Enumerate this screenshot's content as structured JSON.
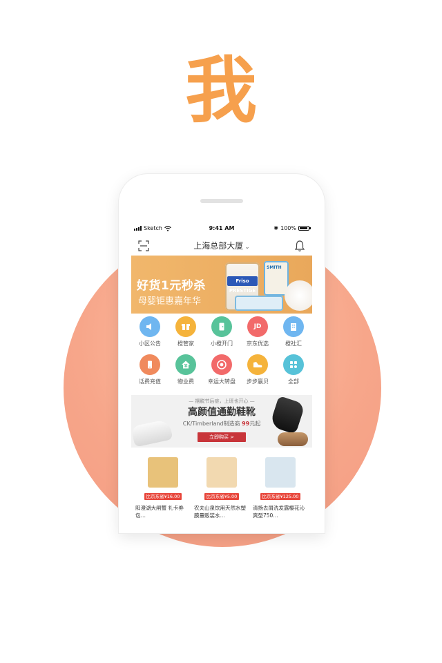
{
  "hero": {
    "title": "我"
  },
  "status_bar": {
    "carrier": "Sketch",
    "time": "9:41 AM",
    "battery": "100%"
  },
  "nav": {
    "title": "上海总部大厦",
    "caret": "⌄"
  },
  "banner": {
    "headline": "好货1元秒杀",
    "subline": "母婴钜惠嘉年华",
    "product_label_1": "Friso PRESTIGE",
    "product_label_2": "SMITH"
  },
  "services": [
    {
      "label": "小区公告",
      "icon": "speaker-icon",
      "color": "#6fb6f0"
    },
    {
      "label": "橙管家",
      "icon": "gift-icon",
      "color": "#f5b33b"
    },
    {
      "label": "小橙开门",
      "icon": "door-icon",
      "color": "#58c39a"
    },
    {
      "label": "京东优选",
      "icon": "jd-icon",
      "color": "#f26a6a",
      "glyph": "JD"
    },
    {
      "label": "橙社汇",
      "icon": "building-icon",
      "color": "#6fb6f0"
    },
    {
      "label": "话费充值",
      "icon": "phone-icon",
      "color": "#f08a5d"
    },
    {
      "label": "物业费",
      "icon": "home-yen-icon",
      "color": "#58c39a",
      "glyph": "¥"
    },
    {
      "label": "幸运大转盘",
      "icon": "wheel-icon",
      "color": "#f26a6a"
    },
    {
      "label": "步步赢贝",
      "icon": "shoe-icon",
      "color": "#f5b33b"
    },
    {
      "label": "全部",
      "icon": "apps-icon",
      "color": "#57c2d8"
    }
  ],
  "promo": {
    "tagline": "— 摆脱节后症，上班也开心 —",
    "title": "高颜值通勤鞋靴",
    "sub_prefix": "CK/Timberland制造商 ",
    "sub_price": "99",
    "sub_suffix": "元起",
    "button": "立即购买 >"
  },
  "products": [
    {
      "price": "比京东省¥16.00",
      "name": "阳澄湖大闸蟹 礼卡券包…",
      "color": "#e8c27a"
    },
    {
      "price": "比京东省¥5.00",
      "name": "农夫山泉饮用天然水塑膜量贩装水…",
      "color": "#f2d9b0"
    },
    {
      "price": "比京东省¥125.00",
      "name": "清扬去屑洗发露樱花沁爽型750…",
      "color": "#d9e6ef"
    }
  ],
  "colors": {
    "accent": "#f6a04d",
    "sale_red": "#e8473c",
    "promo_red": "#c8353a"
  }
}
